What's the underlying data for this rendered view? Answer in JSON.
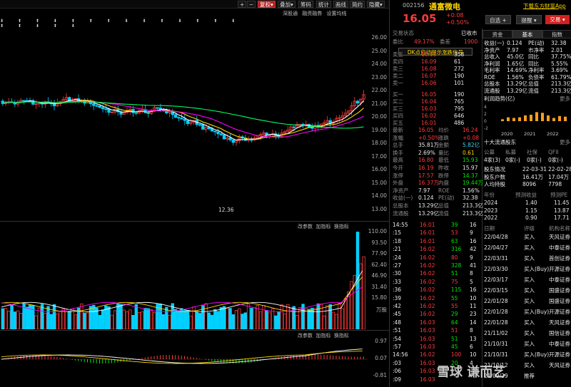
{
  "toolbar": {
    "plus": "+",
    "minus": "−",
    "fuquan": "复权",
    "overlay": "叠加",
    "chips": "筹码",
    "stats": "统计",
    "screen": "画线",
    "brief": "简约",
    "hide": "隐藏"
  },
  "subtools": [
    "深股通",
    "融资融券",
    "设置均线"
  ],
  "markers": "⬇ ⬆ ⬆ ⬇ ⬆ ⬆ ⬆ ⬇ ⬇ ⬆ ⬇ ⬆ ⬆ ⬇ ⬆ ⬆ ⬇ ⬆ ⬇",
  "price_axis": [
    "26.00",
    "25.00",
    "24.00",
    "23.00",
    "22.00",
    "21.00",
    "20.00",
    "19.00",
    "18.00",
    "17.00",
    "16.00",
    "15.00",
    "14.00",
    "13.00"
  ],
  "low_label": "12.36",
  "vol_panel": {
    "tabs": [
      "改参数",
      "加指标",
      "换指标"
    ],
    "axis": [
      "110.00",
      "93.50",
      "77.90",
      "62.40",
      "46.90",
      "31.40",
      "15.80",
      "万股"
    ]
  },
  "macd_panel": {
    "tabs": [
      "改参数",
      "加指标",
      "换指标"
    ],
    "axis": [
      "0.97",
      "0.07",
      "-0.81"
    ]
  },
  "stock": {
    "code": "002156",
    "name": "通富微电",
    "price": "16.05",
    "change": "+0.08",
    "pct": "+0.50%",
    "select_btn": "自选",
    "alert_btn": "提醒",
    "trade_btn": "交易",
    "app_link": "下载东方财富App",
    "session": "交易状态",
    "status": "已收市",
    "weibi_label": "委比",
    "weibi": "49.17%",
    "weicha_label": "委差",
    "weicha": "1900",
    "signal": "DK点自动提示涨跌信号"
  },
  "asks": [
    {
      "label": "卖五",
      "price": "16.10",
      "vol": "358"
    },
    {
      "label": "卖四",
      "price": "16.09",
      "vol": "61"
    },
    {
      "label": "卖三",
      "price": "16.08",
      "vol": "272"
    },
    {
      "label": "卖二",
      "price": "16.07",
      "vol": "190"
    },
    {
      "label": "卖一",
      "price": "16.06",
      "vol": "101"
    }
  ],
  "bids": [
    {
      "label": "买一",
      "price": "16.05",
      "vol": "190"
    },
    {
      "label": "买二",
      "price": "16.04",
      "vol": "765"
    },
    {
      "label": "买三",
      "price": "16.03",
      "vol": "795"
    },
    {
      "label": "买四",
      "price": "16.02",
      "vol": "646"
    },
    {
      "label": "买五",
      "price": "16.01",
      "vol": "486"
    }
  ],
  "quote": [
    {
      "l": "最新",
      "v": "16.05",
      "l2": "均价",
      "v2": "16.24"
    },
    {
      "l": "涨幅",
      "v": "+0.50%",
      "l2": "涨跌",
      "v2": "+0.08"
    },
    {
      "l": "总手",
      "v": "35.81万",
      "l2": "金额",
      "v2": "5.82亿"
    },
    {
      "l": "换手",
      "v": "2.69%",
      "l2": "量比",
      "v2": "0.61"
    },
    {
      "l": "最高",
      "v": "16.80",
      "l2": "最低",
      "v2": "15.93"
    },
    {
      "l": "今开",
      "v": "16.19",
      "l2": "昨收",
      "v2": "15.97"
    },
    {
      "l": "涨停",
      "v": "17.57",
      "l2": "跌停",
      "v2": "14.37"
    },
    {
      "l": "外盘",
      "v": "16.37万",
      "l2": "内盘",
      "v2": "19.44万"
    },
    {
      "l": "净资产",
      "v": "7.97",
      "l2": "ROE",
      "v2": "1.56%"
    },
    {
      "l": "收益(一)",
      "v": "0.124",
      "l2": "PE(动)",
      "v2": "32.38"
    },
    {
      "l": "总股本",
      "v": "13.29亿",
      "l2": "总值",
      "v2": "213.3亿"
    },
    {
      "l": "流通股",
      "v": "13.29亿",
      "l2": "流值",
      "v2": "213.3亿"
    }
  ],
  "ticks": [
    {
      "t": "14:55",
      "p": "16.01",
      "v": "39",
      "n": "16"
    },
    {
      "t": ":15",
      "p": "16.01",
      "v": "53",
      "n": "9"
    },
    {
      "t": ":18",
      "p": "16.01",
      "v": "63",
      "n": "16"
    },
    {
      "t": ":21",
      "p": "16.02",
      "v": "316",
      "n": "42"
    },
    {
      "t": ":24",
      "p": "16.02",
      "v": "80",
      "n": "9"
    },
    {
      "t": ":27",
      "p": "16.02",
      "v": "328",
      "n": "41"
    },
    {
      "t": ":30",
      "p": "16.02",
      "v": "51",
      "n": "8"
    },
    {
      "t": ":33",
      "p": "16.02",
      "v": "75",
      "n": "5"
    },
    {
      "t": ":36",
      "p": "16.02",
      "v": "115",
      "n": "16"
    },
    {
      "t": ":39",
      "p": "16.02",
      "v": "55",
      "n": "10"
    },
    {
      "t": ":42",
      "p": "16.02",
      "v": "55",
      "n": "11"
    },
    {
      "t": ":45",
      "p": "16.02",
      "v": "29",
      "n": "23"
    },
    {
      "t": ":48",
      "p": "16.03",
      "v": "64",
      "n": "14"
    },
    {
      "t": ":51",
      "p": "16.03",
      "v": "51",
      "n": "8"
    },
    {
      "t": ":54",
      "p": "16.03",
      "v": "51",
      "n": "13"
    },
    {
      "t": ":57",
      "p": "16.03",
      "v": "45",
      "n": "6"
    },
    {
      "t": "14:56",
      "p": "16.02",
      "v": "100",
      "n": "10"
    },
    {
      "t": ":03",
      "p": "16.03",
      "v": "20",
      "n": "4"
    },
    {
      "t": ":06",
      "p": "16.03",
      "v": "",
      "n": ""
    },
    {
      "t": ":09",
      "p": "16.03",
      "v": "",
      "n": ""
    }
  ],
  "f10": {
    "tabs": [
      "资金",
      "基本",
      "指数"
    ],
    "rows": [
      {
        "a": "收益(一)",
        "b": "0.124",
        "c": "PE(动)",
        "d": "32.38"
      },
      {
        "a": "净资产",
        "b": "7.97",
        "c": "市净率",
        "d": "2.01"
      },
      {
        "a": "总收入",
        "b": "45.0亿",
        "c": "同比",
        "d": "37.75%"
      },
      {
        "a": "净利润",
        "b": "1.65亿",
        "c": "同比",
        "d": "5.55%"
      },
      {
        "a": "毛利率",
        "b": "14.69%",
        "c": "净利率",
        "d": "3.69%"
      },
      {
        "a": "ROE",
        "b": "1.56%",
        "c": "负债率",
        "d": "61.79%"
      },
      {
        "a": "总股本",
        "b": "13.29亿",
        "c": "总值",
        "d": "213.3亿"
      },
      {
        "a": "流通股",
        "b": "13.29亿",
        "c": "流值",
        "d": "213.3亿"
      }
    ],
    "profit_title": "利润趋势(亿)",
    "more": "更多",
    "profit_years": [
      "2020",
      "2021",
      "2022"
    ],
    "profit_axis": [
      "4",
      "2",
      "0",
      "-2"
    ],
    "top10_title": "十大流通股东",
    "rating_hdr": [
      "公募",
      "私募",
      "社保",
      "QFII"
    ],
    "rating_vals": [
      "4家(3)",
      "0家(-)",
      "0家(-)",
      "0家(-)"
    ],
    "holders": [
      {
        "a": "股东情况",
        "b": "22-03-31",
        "d": "22-02-28"
      },
      {
        "a": "股东户数",
        "b": "16.41万",
        "d": "17.04万"
      },
      {
        "a": "人均持股",
        "b": "8096",
        "d": "7798"
      }
    ],
    "forecast_hdr": [
      "年份",
      "预测收益",
      "预测PE"
    ],
    "forecast": [
      {
        "y": "2024",
        "e": "1.40",
        "pe": "11.45"
      },
      {
        "y": "2023",
        "e": "1.15",
        "pe": "13.87"
      },
      {
        "y": "2022",
        "e": "0.90",
        "pe": "17.71"
      }
    ],
    "report_hdr": [
      "日期",
      "评级",
      "机构名称"
    ],
    "reports": [
      {
        "d": "22/04/28",
        "r": "买入",
        "o": "天风证券"
      },
      {
        "d": "22/04/27",
        "r": "买入",
        "o": "中泰证券"
      },
      {
        "d": "22/03/31",
        "r": "买入",
        "o": "首创证券"
      },
      {
        "d": "22/03/30",
        "r": "买入(Buy)",
        "o": "开源证券"
      },
      {
        "d": "22/03/17",
        "r": "买入",
        "o": "中泰证券"
      },
      {
        "d": "22/03/15",
        "r": "买入",
        "o": "国盛证券"
      },
      {
        "d": "22/01/28",
        "r": "买入",
        "o": "国盛证券"
      },
      {
        "d": "22/01/28",
        "r": "买入(Buy)",
        "o": "开源证券"
      },
      {
        "d": "22/01/28",
        "r": "买入",
        "o": "天风证券"
      },
      {
        "d": "21/11/02",
        "r": "买入",
        "o": "国信证券"
      },
      {
        "d": "21/10/31",
        "r": "买入",
        "o": "中泰证券"
      },
      {
        "d": "21/10/31",
        "r": "买入(Buy)",
        "o": "开源证券"
      },
      {
        "d": "21/10/12",
        "r": "买入",
        "o": "天风证券"
      },
      {
        "d": "21/09/29",
        "r": "推荐",
        "o": ""
      }
    ]
  },
  "watermark": "雪球 谦而艺",
  "colors": {
    "up": "#ff3b3b",
    "down": "#00e600",
    "ma5": "#ffffff",
    "ma10": "#ffd700",
    "ma20": "#ff00ff",
    "ma60": "#00ff66",
    "vol_up": "#ff3b3b",
    "vol_down": "#00d0ff"
  }
}
